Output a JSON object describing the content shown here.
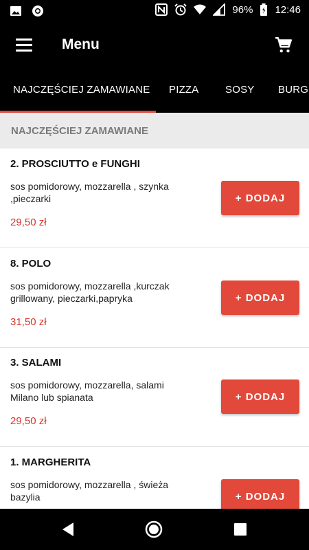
{
  "status_bar": {
    "battery": "96%",
    "time": "12:46",
    "icons": [
      "image-icon",
      "circle-icon",
      "nfc-icon",
      "alarm-icon",
      "wifi-icon",
      "signal-icon",
      "battery-icon"
    ]
  },
  "app_bar": {
    "title": "Menu",
    "menu_icon": "hamburger-icon",
    "cart_icon": "cart-icon"
  },
  "tabs": [
    {
      "label": "NAJCZĘŚCIEJ ZAMAWIANE",
      "selected": true
    },
    {
      "label": "PIZZA",
      "selected": false
    },
    {
      "label": "SOSY",
      "selected": false
    },
    {
      "label": "BURGE",
      "selected": false
    }
  ],
  "section": {
    "title": "NAJCZĘŚCIEJ ZAMAWIANE"
  },
  "items": [
    {
      "name": "2. PROSCIUTTO e FUNGHI",
      "desc": "sos pomidorowy, mozzarella , szynka ,pieczarki",
      "price": "29,50 zł",
      "button": "+ DODAJ"
    },
    {
      "name": "8. POLO",
      "desc": "sos pomidorowy, mozzarella ,kurczak grillowany, pieczarki,papryka",
      "price": "31,50 zł",
      "button": "+ DODAJ"
    },
    {
      "name": "3. SALAMI",
      "desc": "sos pomidorowy, mozzarella, salami Milano lub spianata",
      "price": "29,50 zł",
      "button": "+ DODAJ"
    },
    {
      "name": "1. MARGHERITA",
      "desc": "sos pomidorowy, mozzarella , świeża bazylia",
      "price": "",
      "button": "+ DODAJ"
    }
  ],
  "nav_bar": {
    "icons": [
      "back-icon",
      "home-icon",
      "recents-icon"
    ]
  },
  "colors": {
    "accent": "#e2493b",
    "price": "#d9352a",
    "bar": "#000000",
    "section_bg": "#ebebeb"
  }
}
